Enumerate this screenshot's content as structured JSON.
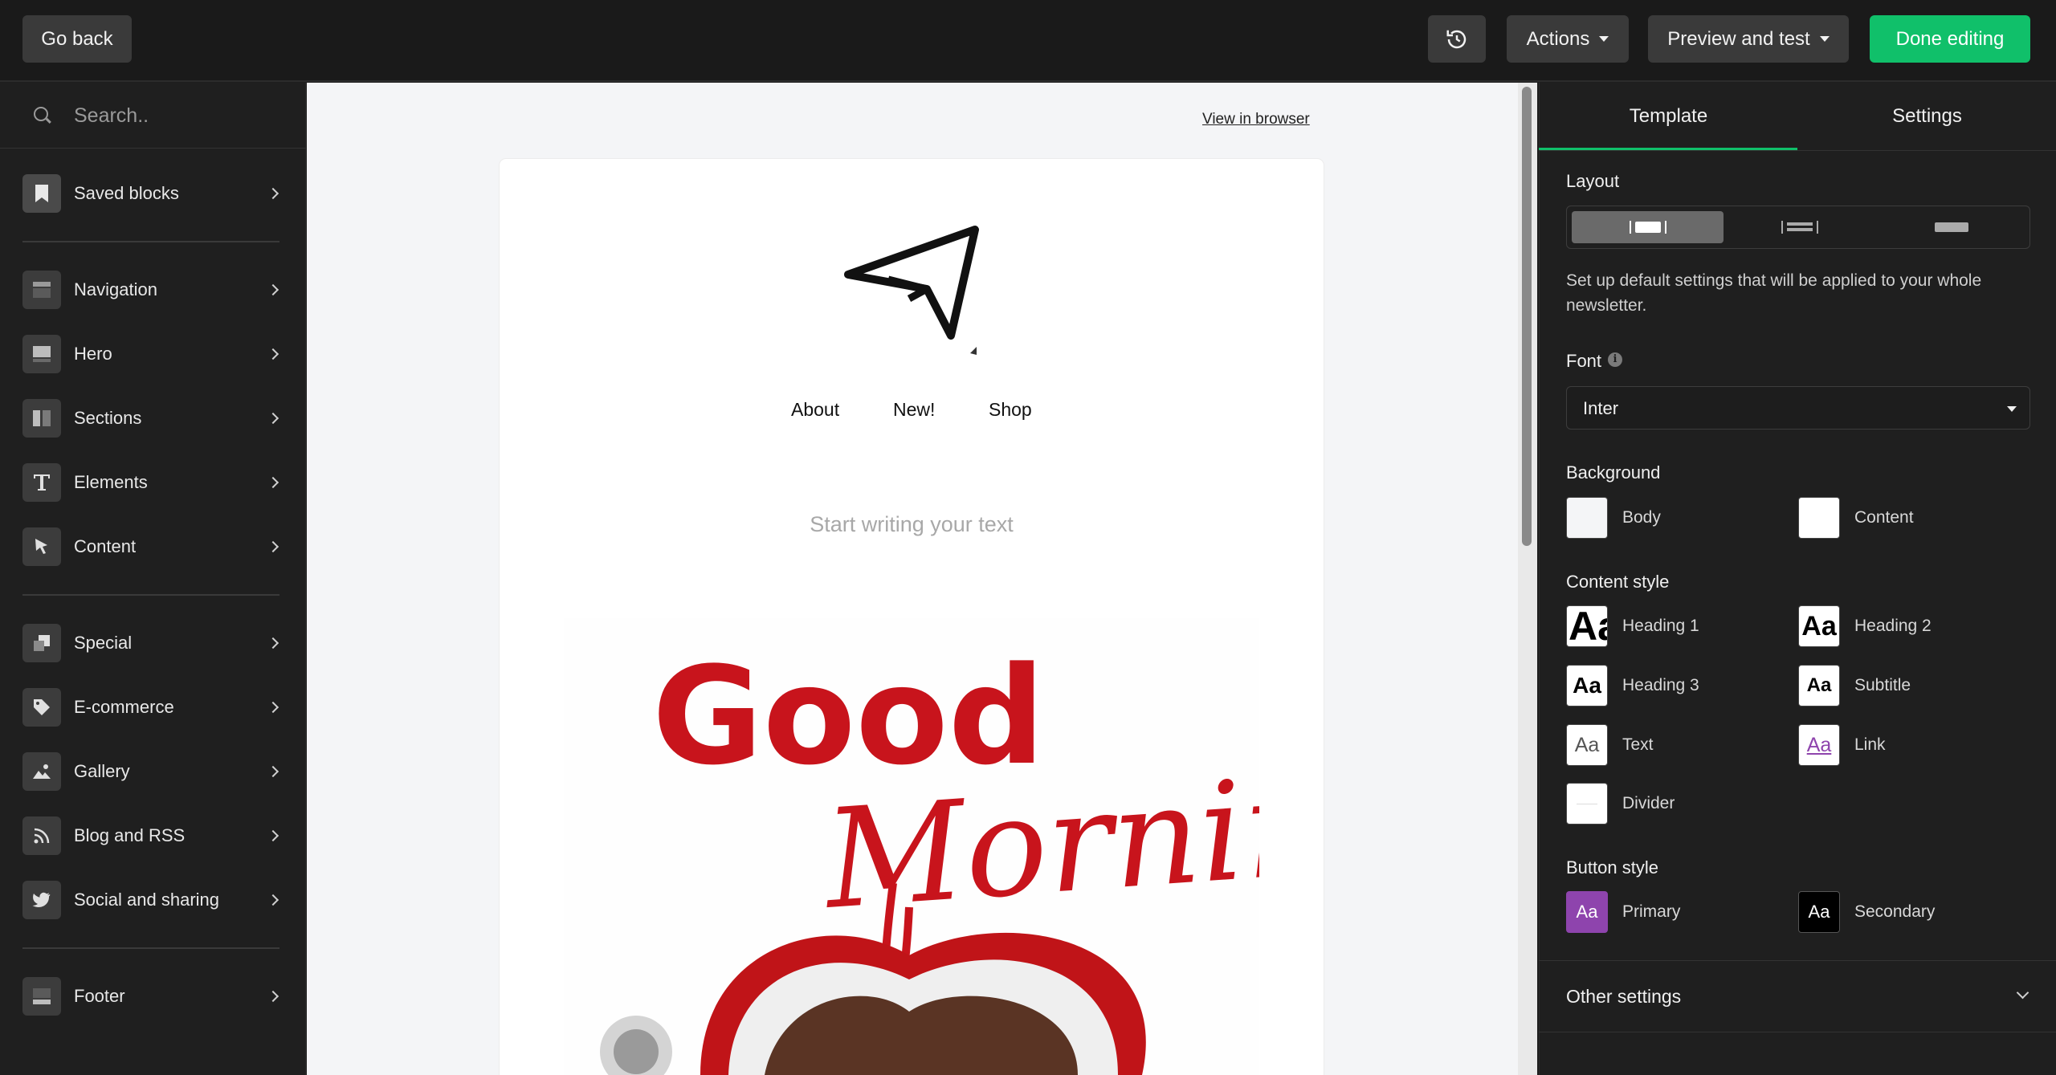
{
  "topbar": {
    "go_back": "Go back",
    "actions": "Actions",
    "preview_and_test": "Preview and test",
    "done_editing": "Done editing"
  },
  "search": {
    "placeholder": "Search.."
  },
  "sidebar": {
    "items": [
      {
        "label": "Saved blocks",
        "icon": "bookmark-icon"
      },
      {
        "label": "Navigation",
        "icon": "navigation-block-icon"
      },
      {
        "label": "Hero",
        "icon": "hero-block-icon"
      },
      {
        "label": "Sections",
        "icon": "sections-block-icon"
      },
      {
        "label": "Elements",
        "icon": "text-t-icon"
      },
      {
        "label": "Content",
        "icon": "cursor-arrow-icon"
      },
      {
        "label": "Special",
        "icon": "layers-icon"
      },
      {
        "label": "E-commerce",
        "icon": "tag-icon"
      },
      {
        "label": "Gallery",
        "icon": "image-mountain-icon"
      },
      {
        "label": "Blog and RSS",
        "icon": "rss-icon"
      },
      {
        "label": "Social and sharing",
        "icon": "twitter-bird-icon"
      },
      {
        "label": "Footer",
        "icon": "footer-block-icon"
      }
    ]
  },
  "canvas": {
    "view_in_browser": "View in browser",
    "nav_links": [
      "About",
      "New!",
      "Shop"
    ],
    "text_placeholder": "Start writing your text",
    "hero_word1": "Good",
    "hero_word2": "Morning"
  },
  "panel": {
    "tabs": [
      "Template",
      "Settings"
    ],
    "layout_label": "Layout",
    "description": "Set up default settings that will be applied to your whole newsletter.",
    "font_label": "Font",
    "font_value": "Inter",
    "background_label": "Background",
    "background": [
      "Body",
      "Content"
    ],
    "content_style_label": "Content style",
    "content_styles": [
      "Heading 1",
      "Heading 2",
      "Heading 3",
      "Subtitle",
      "Text",
      "Link",
      "Divider"
    ],
    "swatch_text": "Aa",
    "button_style_label": "Button style",
    "button_styles": [
      "Primary",
      "Secondary"
    ],
    "other_settings": "Other settings"
  },
  "colors": {
    "accent": "#10c06a",
    "primary_button": "#8e44ad",
    "secondary_button": "#000000",
    "link": "#8e44ad",
    "hero_red": "#c8141c"
  }
}
